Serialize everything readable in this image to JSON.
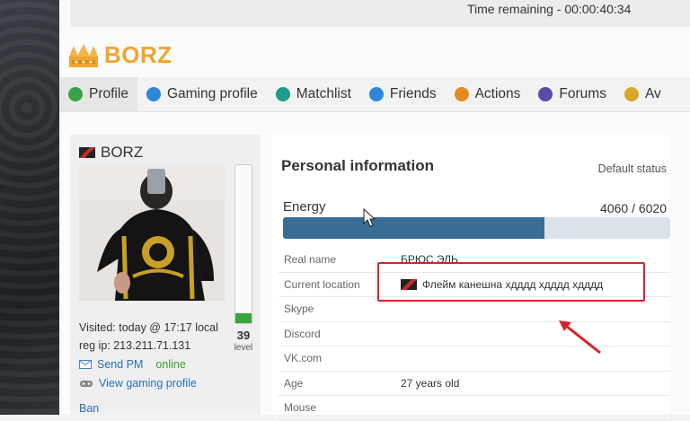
{
  "top_bar": {
    "time_remaining": "Time remaining - 00:00:40:34"
  },
  "logo": {
    "text": "BORZ"
  },
  "tabs": [
    {
      "label": "Profile",
      "icon": "profile-icon",
      "color": "#3aa14b"
    },
    {
      "label": "Gaming profile",
      "icon": "info-icon",
      "color": "#2f86d6"
    },
    {
      "label": "Matchlist",
      "icon": "radiation-icon",
      "color": "#1c9d8b"
    },
    {
      "label": "Friends",
      "icon": "friends-icon",
      "color": "#2f86d6"
    },
    {
      "label": "Actions",
      "icon": "actions-icon",
      "color": "#e48a21"
    },
    {
      "label": "Forums",
      "icon": "forums-icon",
      "color": "#5b4ca8"
    },
    {
      "label": "Av",
      "icon": "award-icon",
      "color": "#d8a62b"
    }
  ],
  "profile": {
    "username": "BORZ",
    "level": "39",
    "level_label": "level",
    "level_progress": 0.06,
    "visited": "Visited: today @ 17:17 local",
    "reg_ip": "reg ip: 213.211.71.131",
    "send_pm": "Send PM",
    "online_status": "online",
    "view_gaming_profile": "View gaming profile",
    "ban": "Ban"
  },
  "personal_info": {
    "title": "Personal information",
    "default_status": "Default status",
    "energy_label": "Energy",
    "energy_value": "4060 / 6020",
    "energy_current": 4060,
    "energy_max": 6020,
    "rows": [
      {
        "label": "Real name",
        "value": "БРЮС ЭЛЬ"
      },
      {
        "label": "Current location",
        "value": "Флейм канешна хдддд хдддд хдддд"
      },
      {
        "label": "Skype",
        "value": ""
      },
      {
        "label": "Discord",
        "value": ""
      },
      {
        "label": "VK.com",
        "value": ""
      },
      {
        "label": "Age",
        "value": "27 years old"
      },
      {
        "label": "Mouse",
        "value": ""
      }
    ]
  },
  "annotation": {
    "highlight_color": "#d2252b"
  }
}
